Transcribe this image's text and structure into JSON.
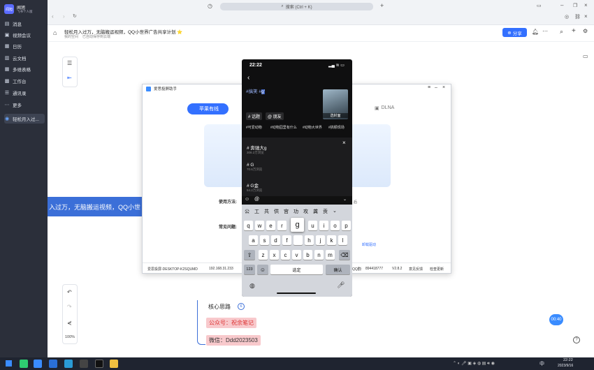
{
  "sidebar": {
    "user_name": "闻旭",
    "user_sub": "飞书个人版",
    "avatar": "闻旭",
    "items": [
      {
        "label": "消息",
        "icon": "chat-icon"
      },
      {
        "label": "视频会议",
        "icon": "video-icon"
      },
      {
        "label": "日历",
        "icon": "calendar-icon"
      },
      {
        "label": "云文档",
        "icon": "doc-icon"
      },
      {
        "label": "多维表格",
        "icon": "table-icon"
      },
      {
        "label": "工作台",
        "icon": "grid-icon"
      },
      {
        "label": "通讯录",
        "icon": "contacts-icon"
      },
      {
        "label": "更多",
        "icon": "more-icon"
      },
      {
        "label": "轻松月入过...",
        "icon": "mindmap-icon"
      }
    ]
  },
  "topbar": {
    "search_placeholder": "搜索 (Ctrl + K)"
  },
  "doc": {
    "title": "轻松月入过万，无脑搬运视频，QQ小世界广告共享计划 ⭐",
    "location": "我的空间",
    "saved": "已自动保存到云端",
    "share": "分享"
  },
  "mindmap": {
    "root_text": "入过万，无脑搬运视频，QQ小世",
    "nodes": [
      "核心思路",
      "公众号：祝余笔记",
      "微信：Ddd2023503"
    ],
    "badge": "6",
    "zoom": "100%"
  },
  "mirror_app": {
    "title": "爱思投屏助手",
    "tab_apple": "苹果有线",
    "tab_dlna": "DLNA",
    "usage_label": "使用方法:",
    "faq_label": "常见问题:",
    "footer_device": "爱思投屏-DESKTOP-K2SQUMD",
    "footer_ip": "192.168.31.233",
    "footer_qq_label": "QQ群:",
    "footer_qq": "894418777",
    "footer_version": "V2.8.2",
    "footer_feedback": "意见反馈",
    "footer_update": "检查更新",
    "side_texts": [
      "后",
      "卸载驱动"
    ]
  },
  "phone": {
    "time": "22:22",
    "typed": "#搞笑 #",
    "typed_highlight": "g'",
    "cover_label": "选封面",
    "tags": [
      "# 话题",
      "@ 朋友"
    ],
    "hashtag_suggestions": [
      "#可爱动物",
      "#动物园里有什么",
      "#动物大世界",
      "#搞颖现场"
    ],
    "topics": [
      {
        "name": "# 奔驰大g",
        "count": "308.2万浏览"
      },
      {
        "name": "# G",
        "count": "70.6万浏览"
      },
      {
        "name": "# G金",
        "count": "54.2万浏览"
      }
    ],
    "candidates": [
      "公",
      "工",
      "共",
      "供",
      "宫",
      "功",
      "攻",
      "龚",
      "贡"
    ],
    "row1": [
      "q",
      "w",
      "e",
      "r",
      "g",
      "u",
      "i",
      "o",
      "p"
    ],
    "row2": [
      "a",
      "s",
      "d",
      "f",
      "",
      "h",
      "j",
      "k",
      "l"
    ],
    "row3": [
      "z",
      "x",
      "c",
      "v",
      "b",
      "n",
      "m"
    ],
    "num_key": "123",
    "space_key": "选定",
    "confirm_key": "确认"
  },
  "floating": {
    "time_badge": "00:40"
  },
  "taskbar": {
    "time": "22:22",
    "date": "2023/9/16",
    "ime": "中"
  },
  "colors": {
    "accent": "#3370ff",
    "sidebar": "#2b2f3a",
    "node_pink": "#f8c9cc",
    "root_blue": "#3b6fd8"
  }
}
